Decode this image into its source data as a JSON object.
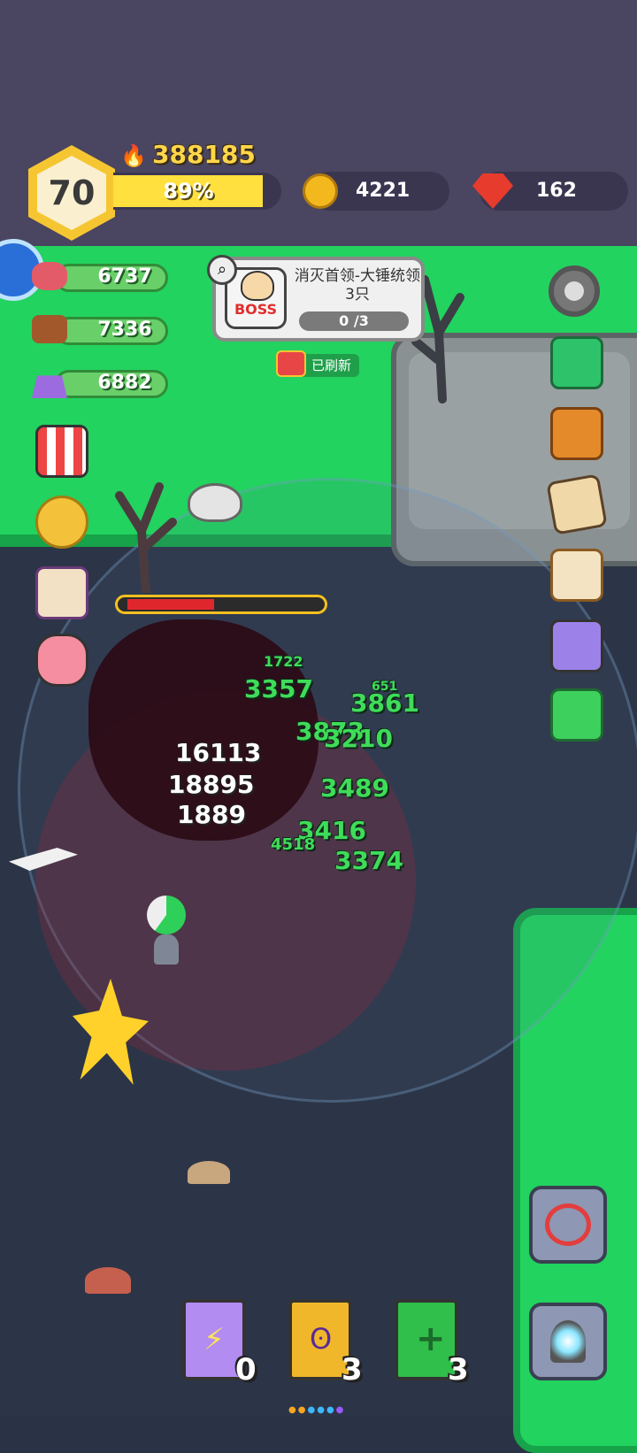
{
  "player": {
    "level": "70",
    "power": "388185",
    "xp_percent_label": "89%",
    "xp_fraction": 0.89
  },
  "currency": {
    "coins": "4221",
    "gems": "162"
  },
  "resources": [
    {
      "name": "meat-icon",
      "value": "6737"
    },
    {
      "name": "wood-icon",
      "value": "7336"
    },
    {
      "name": "ingot-icon",
      "value": "6882"
    }
  ],
  "quest": {
    "badge": "BOSS",
    "title": "消灭首领-大锤统领3只",
    "progress": "0 /3",
    "refresh_label": "已刷新"
  },
  "boss_hp_fraction": 0.46,
  "damage_numbers": [
    {
      "text": "1722",
      "style": "green-small"
    },
    {
      "text": "3357",
      "style": "green"
    },
    {
      "text": "651",
      "style": "green-small"
    },
    {
      "text": "3861",
      "style": "green"
    },
    {
      "text": "3873",
      "style": "green"
    },
    {
      "text": "3210",
      "style": "green"
    },
    {
      "text": "16113",
      "style": "white"
    },
    {
      "text": "18895",
      "style": "white"
    },
    {
      "text": "1889",
      "style": "white"
    },
    {
      "text": "3489",
      "style": "green"
    },
    {
      "text": "3416",
      "style": "green"
    },
    {
      "text": "4518",
      "style": "green-small"
    },
    {
      "text": "3374",
      "style": "green"
    }
  ],
  "skill_books": [
    {
      "color": "#b28cf0",
      "icon": "lightning-icon",
      "count": "0"
    },
    {
      "color": "#f0b72a",
      "icon": "wing-icon",
      "count": "3"
    },
    {
      "color": "#2fbf4a",
      "icon": "plus-icon",
      "count": "3"
    }
  ],
  "colors": {
    "grass": "#22d35f",
    "ground": "#2c3547",
    "accent_gold": "#f6c632",
    "gem_red": "#e73b2d"
  }
}
